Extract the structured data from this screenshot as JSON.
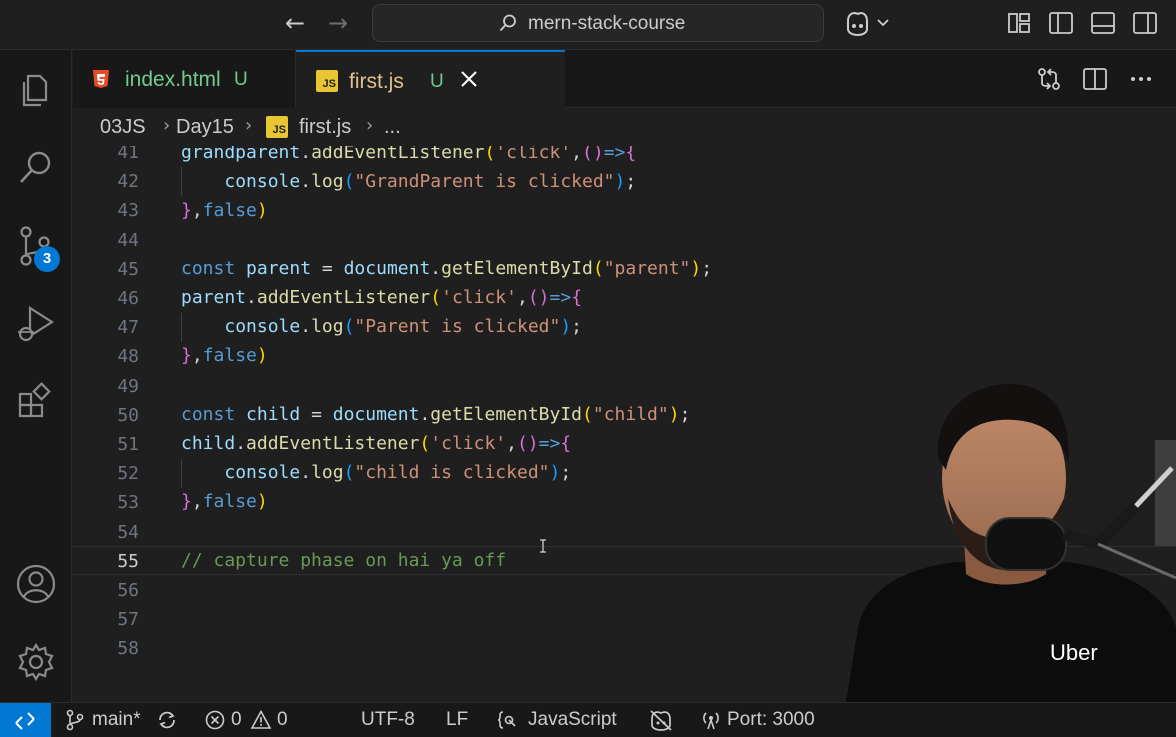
{
  "titlebar": {
    "search_text": "mern-stack-course",
    "icons": [
      "arrow-left-icon",
      "arrow-right-icon",
      "search-icon",
      "copilot-icon",
      "customize-layout-icon",
      "toggle-primary-sidebar-icon",
      "toggle-panel-icon",
      "toggle-secondary-sidebar-icon"
    ]
  },
  "activity_bar": {
    "items": [
      "explorer-icon",
      "search-icon",
      "source-control-icon",
      "run-debug-icon",
      "extensions-icon",
      "accounts-icon",
      "manage-gear-icon"
    ],
    "source_control_badge": "3"
  },
  "tabs": [
    {
      "label": "index.html",
      "status": "U",
      "icon": "html5-icon",
      "active": false
    },
    {
      "label": "first.js",
      "status": "U",
      "icon": "js-icon",
      "active": true
    }
  ],
  "breadcrumb": {
    "items": [
      "03JS",
      "Day15",
      "first.js",
      "..."
    ],
    "js_icon_text": "JS"
  },
  "editor": {
    "current_line": "55",
    "line_numbers": [
      "41",
      "42",
      "43",
      "44",
      "45",
      "46",
      "47",
      "48",
      "49",
      "50",
      "51",
      "52",
      "53",
      "54",
      "55",
      "56",
      "57",
      "58"
    ]
  },
  "overlay": {
    "shirt_text": "Uber"
  },
  "statusbar": {
    "branch": "main*",
    "errors": "0",
    "warnings": "0",
    "encoding": "UTF-8",
    "eol": "LF",
    "language": "JavaScript",
    "port": "Port: 3000",
    "remote_color": "#0078d4"
  }
}
